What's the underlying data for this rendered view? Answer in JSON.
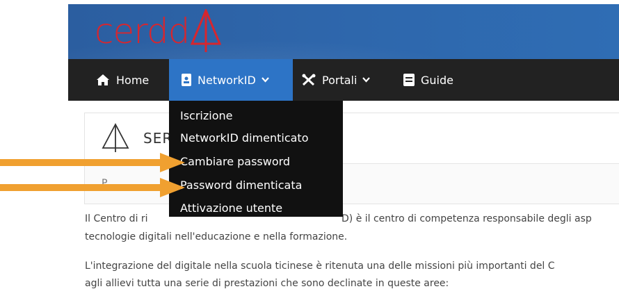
{
  "header": {
    "logo_text": "cerdd"
  },
  "nav": {
    "items": [
      {
        "label": "Home",
        "icon": "home-icon"
      },
      {
        "label": "NetworkID",
        "icon": "id-badge-icon",
        "active": true
      },
      {
        "label": "Portali",
        "icon": "tools-icon"
      },
      {
        "label": "Guide",
        "icon": "book-icon"
      }
    ]
  },
  "dropdown": {
    "items": [
      "Iscrizione",
      "NetworkID dimenticato",
      "Cambiare password",
      "Password dimenticata",
      "Attivazione utente"
    ]
  },
  "content": {
    "title": "SER",
    "faint_text": "P",
    "para1_a": "Il Centro di ri",
    "para1_b": "D) è il centro di competenza responsabile degli asp",
    "para1_line2": "tecnologie digitali nell'educazione e nella formazione.",
    "para2_line1": "L'integrazione del digitale nella scuola ticinese è ritenuta una delle missioni più importanti del C",
    "para2_line2": "agli allievi tutta una serie di prestazioni che sono declinate in queste aree:"
  },
  "colors": {
    "banner": "#2f6db4",
    "navbar": "#222222",
    "nav_active": "#2d74c6",
    "dropdown": "#111111",
    "logo": "#d7262e",
    "arrow": "#f0a030"
  }
}
